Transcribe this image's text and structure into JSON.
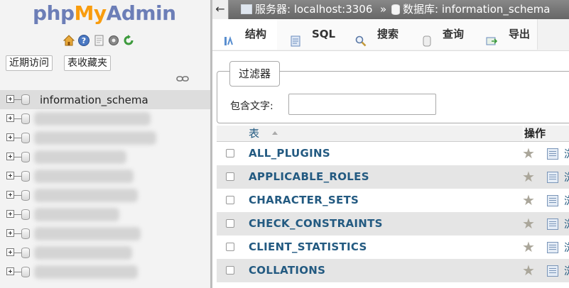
{
  "logo": {
    "part1": "php",
    "part2": "My",
    "part3": "Admin"
  },
  "nav": {
    "icons": [
      "home-icon",
      "help-icon",
      "docs-icon",
      "settings-icon",
      "reload-icon"
    ],
    "recent_label": "近期访问",
    "favorites_label": "表收藏夹",
    "databases": [
      {
        "name": "information_schema",
        "active": true
      },
      {
        "name": "",
        "blurred": true
      },
      {
        "name": "",
        "blurred": true
      },
      {
        "name": "",
        "blurred": true
      },
      {
        "name": "",
        "blurred": true
      },
      {
        "name": "",
        "blurred": true
      },
      {
        "name": "",
        "blurred": true
      },
      {
        "name": "",
        "blurred": true
      },
      {
        "name": "",
        "blurred": true
      },
      {
        "name": "",
        "blurred": true
      }
    ]
  },
  "breadcrumb": {
    "server": "服务器: localhost:3306",
    "separator": "»",
    "database": "数据库: information_schema"
  },
  "tabs": [
    {
      "label": "结构",
      "icon": "structure-icon",
      "active": true
    },
    {
      "label": "SQL",
      "icon": "sql-icon"
    },
    {
      "label": "搜索",
      "icon": "search-icon"
    },
    {
      "label": "查询",
      "icon": "query-icon"
    },
    {
      "label": "导出",
      "icon": "export-icon"
    }
  ],
  "filter": {
    "legend": "过滤器",
    "label": "包含文字:",
    "value": ""
  },
  "table": {
    "col_table": "表",
    "col_actions": "操作",
    "rows": [
      {
        "name": "ALL_PLUGINS"
      },
      {
        "name": "APPLICABLE_ROLES"
      },
      {
        "name": "CHARACTER_SETS"
      },
      {
        "name": "CHECK_CONSTRAINTS"
      },
      {
        "name": "CLIENT_STATISTICS"
      },
      {
        "name": "COLLATIONS"
      }
    ],
    "action_cut_text": "浏"
  },
  "colors": {
    "link": "#235a81",
    "logo_blue": "#6c7eb7",
    "logo_orange": "#f89c0e"
  }
}
